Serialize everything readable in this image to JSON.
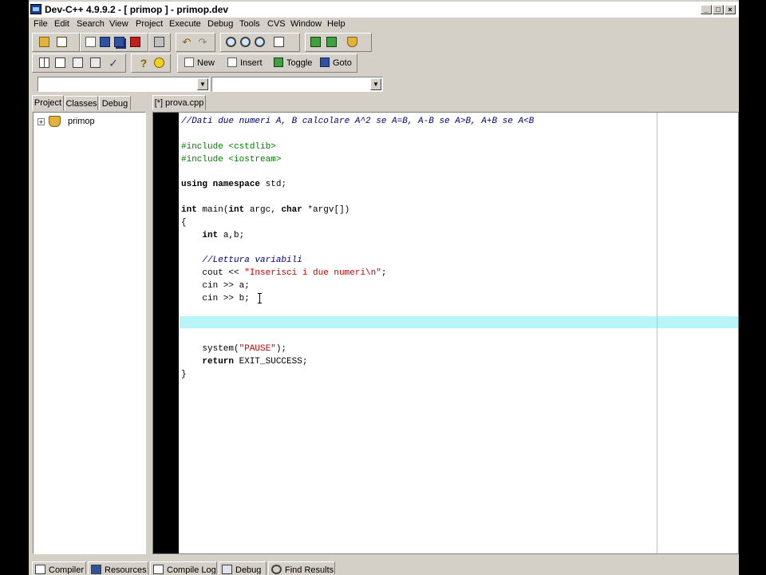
{
  "window": {
    "title": "Dev-C++ 4.9.9.2  -  [ primop ] - primop.dev"
  },
  "menu": [
    "File",
    "Edit",
    "Search",
    "View",
    "Project",
    "Execute",
    "Debug",
    "Tools",
    "CVS",
    "Window",
    "Help"
  ],
  "toolbar": {
    "new_label": "New",
    "insert_label": "Insert",
    "toggle_label": "Toggle",
    "goto_label": "Goto"
  },
  "combos": {
    "class_value": "",
    "member_value": ""
  },
  "left_panel": {
    "tabs": [
      "Project",
      "Classes",
      "Debug"
    ],
    "tree_item": "primop"
  },
  "editor": {
    "tab_label": "[*] prova.cpp",
    "lines": [
      "//Dati due numeri A, B calcolare A^2 se A=B, A-B se A>B, A+B se A<B",
      "",
      "#include <cstdlib>",
      "#include <iostream>",
      "",
      "using namespace std;",
      "",
      "int main(int argc, char *argv[])",
      "{",
      "    int a,b;",
      "",
      "    //Lettura variabili",
      "    cout << \"Inserisci i due numeri\\n\";",
      "    cin >> a;",
      "    cin >> b;",
      "",
      "",
      "",
      "    system(\"PAUSE\");",
      "    return EXIT_SUCCESS;",
      "}"
    ]
  },
  "bottom_tabs": [
    "Compiler",
    "Resources",
    "Compile Log",
    "Debug",
    "Find Results"
  ],
  "colors": {
    "face": "#d4d0c8",
    "comment": "#000080",
    "preprocessor": "#008000",
    "string": "#c00000",
    "current_line": "#b8f4f8"
  }
}
